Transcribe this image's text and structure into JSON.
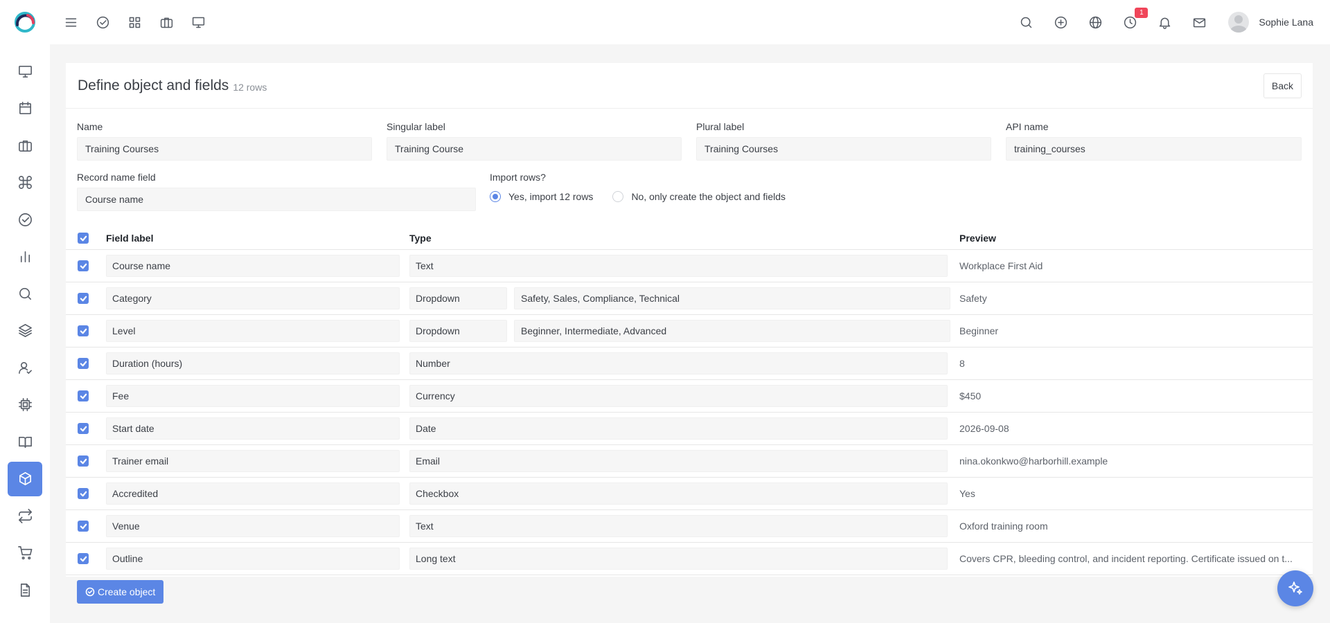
{
  "colors": {
    "accent": "#5b86e5",
    "badge": "#f0465a",
    "background": "#f5f5f5"
  },
  "topbar": {
    "left_icons": [
      "menu-icon",
      "check-circle-icon",
      "grid-icon",
      "briefcase-icon",
      "monitor-icon"
    ],
    "right_icons": [
      "search-icon",
      "plus-circle-icon",
      "globe-icon",
      "clock-icon",
      "bell-icon",
      "mail-icon"
    ],
    "clock_badge": "1",
    "user_name": "Sophie Lana"
  },
  "sidebar": {
    "items": [
      {
        "icon": "monitor-icon"
      },
      {
        "icon": "calendar-icon"
      },
      {
        "icon": "briefcase-icon"
      },
      {
        "icon": "command-icon"
      },
      {
        "icon": "check-circle-icon"
      },
      {
        "icon": "bar-chart-icon"
      },
      {
        "icon": "search-icon"
      },
      {
        "icon": "layers-icon"
      },
      {
        "icon": "user-check-icon"
      },
      {
        "icon": "cpu-icon"
      },
      {
        "icon": "book-open-icon"
      },
      {
        "icon": "box-icon",
        "active": true
      },
      {
        "icon": "repeat-icon"
      },
      {
        "icon": "cart-icon"
      },
      {
        "icon": "file-text-icon"
      }
    ]
  },
  "header": {
    "title": "Define object and fields",
    "row_count": "12 rows",
    "back_label": "Back"
  },
  "form": {
    "name_label": "Name",
    "name_value": "Training Courses",
    "singular_label": "Singular label",
    "singular_value": "Training Course",
    "plural_label": "Plural label",
    "plural_value": "Training Courses",
    "api_label": "API name",
    "api_value": "training_courses",
    "record_name_label": "Record name field",
    "record_name_value": "Course name",
    "import_label": "Import rows?",
    "import_yes": "Yes, import 12 rows",
    "import_no": "No, only create the object and fields",
    "import_selected": "yes"
  },
  "table": {
    "headers": {
      "field_label": "Field label",
      "type": "Type",
      "preview": "Preview"
    },
    "rows": [
      {
        "label": "Course name",
        "type": "Text",
        "options": "",
        "preview": "Workplace First Aid"
      },
      {
        "label": "Category",
        "type": "Dropdown",
        "options": "Safety, Sales, Compliance, Technical",
        "preview": "Safety"
      },
      {
        "label": "Level",
        "type": "Dropdown",
        "options": "Beginner, Intermediate, Advanced",
        "preview": "Beginner"
      },
      {
        "label": "Duration (hours)",
        "type": "Number",
        "options": "",
        "preview": "8"
      },
      {
        "label": "Fee",
        "type": "Currency",
        "options": "",
        "preview": "$450"
      },
      {
        "label": "Start date",
        "type": "Date",
        "options": "",
        "preview": "2026-09-08"
      },
      {
        "label": "Trainer email",
        "type": "Email",
        "options": "",
        "preview": "nina.okonkwo@harborhill.example"
      },
      {
        "label": "Accredited",
        "type": "Checkbox",
        "options": "",
        "preview": "Yes"
      },
      {
        "label": "Venue",
        "type": "Text",
        "options": "",
        "preview": "Oxford training room"
      },
      {
        "label": "Outline",
        "type": "Long text",
        "options": "",
        "preview": "Covers CPR, bleeding control, and incident reporting. Certificate issued on t..."
      }
    ]
  },
  "footer": {
    "create_label": "Create object"
  }
}
